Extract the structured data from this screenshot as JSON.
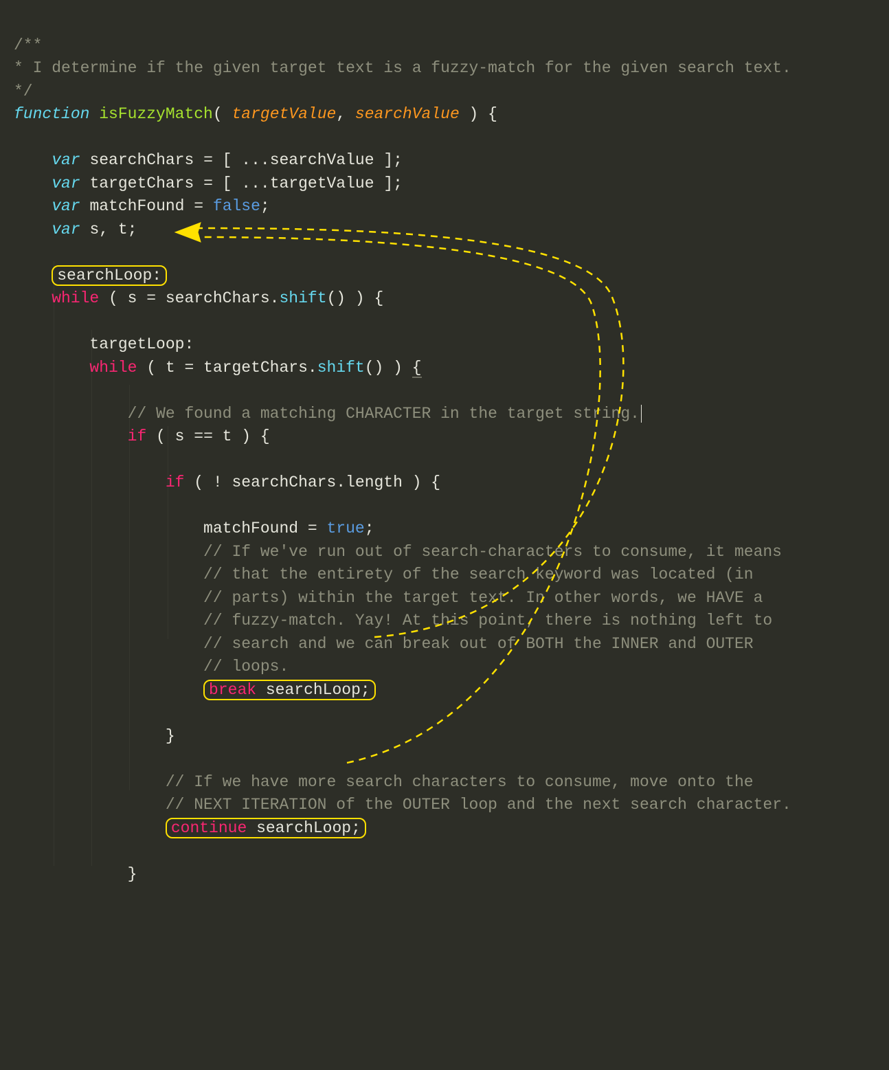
{
  "code": {
    "c1": "/**",
    "c2": "* I determine if the given target text is a fuzzy-match for the given search text.",
    "c3": "*/",
    "kw_function": "function",
    "fn_name": "isFuzzyMatch",
    "paren_open": "( ",
    "param1": "targetValue",
    "comma": ", ",
    "param2": "searchValue",
    "paren_close": " ) {",
    "indent1": "    ",
    "indent2": "        ",
    "indent3": "            ",
    "indent4": "                ",
    "indent5": "                    ",
    "kw_var": "var",
    "sp": " ",
    "decl_searchChars": "searchChars = [ ...searchValue ];",
    "decl_targetChars": "targetChars = [ ...targetValue ];",
    "decl_matchFound_a": "matchFound = ",
    "bool_false": "false",
    "semi": ";",
    "decl_st": "s, t;",
    "label_search": "searchLoop:",
    "while": "while",
    "while1_cond_a": " ( s = searchChars.",
    "shift": "shift",
    "while1_cond_b": "() ) {",
    "label_target": "targetLoop:",
    "while2_cond_a": " ( t = targetChars.",
    "while2_cond_b": "() ) ",
    "brace_u": "{",
    "cmt_match": "// We found a matching CHARACTER in the target string.",
    "if": "if",
    "if1": " ( s == t ) {",
    "if2": " ( ! searchChars.length ) {",
    "stmt_matchFound_a": "matchFound = ",
    "bool_true": "true",
    "cmt_b1": "// If we've run out of search-characters to consume, it means",
    "cmt_b2": "// that the entirety of the search keyword was located (in",
    "cmt_b3": "// parts) within the target text. In other words, we HAVE a",
    "cmt_b4": "// fuzzy-match. Yay! At this point, there is nothing left to",
    "cmt_b5": "// search and we can break out of BOTH the INNER and OUTER",
    "cmt_b6": "// loops.",
    "break": "break",
    "break_arg": " searchLoop;",
    "brace_close": "}",
    "cmt_c1": "// If we have more search characters to consume, move onto the",
    "cmt_c2": "// NEXT ITERATION of the OUTER loop and the next search character.",
    "continue": "continue",
    "continue_arg": " searchLoop;"
  }
}
